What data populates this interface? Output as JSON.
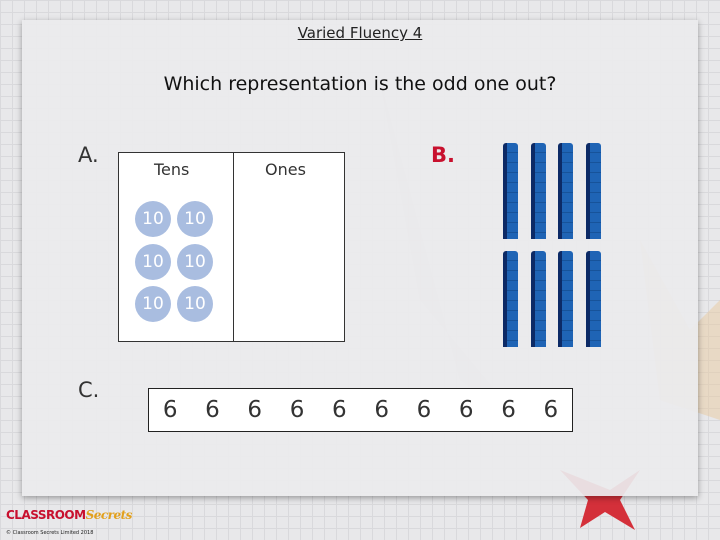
{
  "title": "Varied Fluency 4",
  "question": "Which representation is the odd one out?",
  "options": {
    "a": "A.",
    "b": "B.",
    "c": "C."
  },
  "table": {
    "tens_header": "Tens",
    "ones_header": "Ones",
    "counters": [
      "10",
      "10",
      "10",
      "10",
      "10",
      "10"
    ]
  },
  "b_tens_rods": 8,
  "c_digits": [
    "6",
    "6",
    "6",
    "6",
    "6",
    "6",
    "6",
    "6",
    "6",
    "6"
  ],
  "footer": {
    "logo": "CLASSROOM Secrets",
    "copyright": "© Classroom Secrets Limited 2018"
  },
  "colors": {
    "label_b": "#c8102e",
    "counter": "#a9bde0",
    "rod": "#1f64b5"
  }
}
